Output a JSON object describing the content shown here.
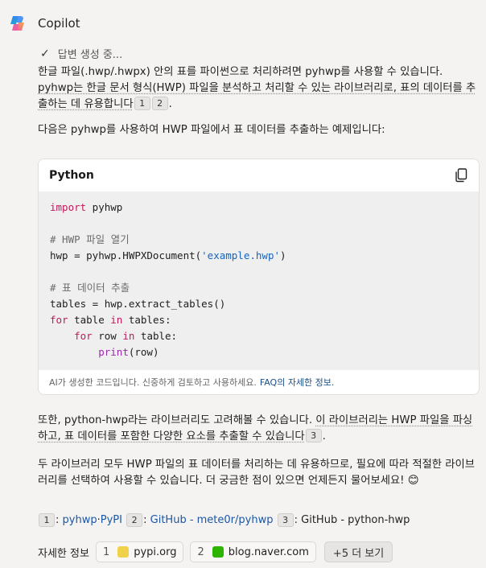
{
  "header": {
    "app_name": "Copilot"
  },
  "status": {
    "text": "답변 생성 중..."
  },
  "intro": {
    "part1": "한글 파일(.hwp/.hwpx) 안의 표를 파이썬으로 처리하려면 pyhwp를 사용할 수 있습니다. ",
    "part2": "pyhwp는 한글 문서 형식(HWP) 파일을 분석하고 처리할 수 있는 라이브러리로, 표의 데이터를 추출하는 데 유용합니다",
    "cite1": "1",
    "cite2": "2",
    "end": "."
  },
  "example_intro": "다음은 pyhwp를 사용하여 HWP 파일에서 표 데이터를 추출하는 예제입니다:",
  "code": {
    "language": "Python",
    "lines": [
      [
        {
          "t": "import",
          "c": "kw"
        },
        {
          "t": " pyhwp",
          "c": ""
        }
      ],
      [],
      [
        {
          "t": "# HWP 파일 열기",
          "c": "cm"
        }
      ],
      [
        {
          "t": "hwp = pyhwp.HWPXDocument(",
          "c": ""
        },
        {
          "t": "'example.hwp'",
          "c": "str"
        },
        {
          "t": ")",
          "c": ""
        }
      ],
      [],
      [
        {
          "t": "# 표 데이터 추출",
          "c": "cm"
        }
      ],
      [
        {
          "t": "tables = hwp.extract_tables()",
          "c": ""
        }
      ],
      [
        {
          "t": "for",
          "c": "kw"
        },
        {
          "t": " table ",
          "c": ""
        },
        {
          "t": "in",
          "c": "kw"
        },
        {
          "t": " tables:",
          "c": ""
        }
      ],
      [
        {
          "t": "    ",
          "c": ""
        },
        {
          "t": "for",
          "c": "kw"
        },
        {
          "t": " row ",
          "c": ""
        },
        {
          "t": "in",
          "c": "kw"
        },
        {
          "t": " table:",
          "c": ""
        }
      ],
      [
        {
          "t": "        ",
          "c": ""
        },
        {
          "t": "print",
          "c": "fn"
        },
        {
          "t": "(row)",
          "c": ""
        }
      ]
    ],
    "disclaimer": "AI가 생성한 코드입니다. 신중하게 검토하고 사용하세요.",
    "faq_link": "FAQ의 자세한 정보."
  },
  "also": {
    "part1": "또한, python-hwp라는 라이브러리도 고려해볼 수 있습니다. ",
    "part2": "이 라이브러리는 HWP 파일을 파싱하고, 표 데이터를 포함한 다양한 요소를 추출할 수 있습니다",
    "cite3": "3",
    "end": "."
  },
  "conclusion": "두 라이브러리 모두 HWP 파일의 표 데이터를 처리하는 데 유용하므로, 필요에 따라 적절한 라이브러리를 선택하여 사용할 수 있습니다. 더 궁금한 점이 있으면 언제든지 물어보세요! 😊",
  "sources": {
    "n1": "1",
    "s1a": "pyhwp",
    "sep": " · ",
    "s1b": "PyPI",
    "n2": "2",
    "s2": "GitHub - mete0r/pyhwp",
    "n3": "3",
    "s3": "GitHub - python-hwp",
    "colon": ":"
  },
  "more_info": {
    "label": "자세한 정보",
    "items": [
      {
        "num": "1",
        "site": "pypi.org",
        "color": "#f0d24a"
      },
      {
        "num": "2",
        "site": "blog.naver.com",
        "color": "#2db400"
      }
    ],
    "more_button": "+5 더 보기"
  }
}
